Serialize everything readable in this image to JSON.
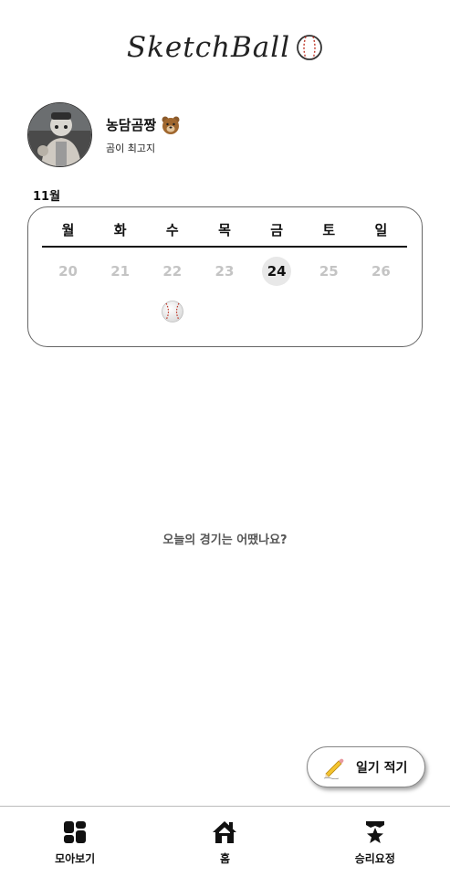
{
  "header": {
    "logo_text": "SketchBall",
    "logo_icon": "baseball-icon"
  },
  "profile": {
    "name": "농담곰짱",
    "name_emoji": "bear-face-icon",
    "bio": "곰이 최고지"
  },
  "calendar": {
    "month": "11월",
    "weekdays": [
      "월",
      "화",
      "수",
      "목",
      "금",
      "토",
      "일"
    ],
    "dates": [
      "20",
      "21",
      "22",
      "23",
      "24",
      "25",
      "26"
    ],
    "today": "24",
    "marked_dates": [
      "22"
    ],
    "mark_icon": "baseball-icon"
  },
  "main": {
    "empty_message": "오늘의 경기는 어땠나요?"
  },
  "write_button": {
    "label": "일기 적기",
    "icon": "pencil-icon"
  },
  "bottom_nav": {
    "items": [
      {
        "label": "모아보기",
        "icon": "grid-icon"
      },
      {
        "label": "홈",
        "icon": "home-icon"
      },
      {
        "label": "승리요정",
        "icon": "trophy-star-icon"
      }
    ]
  },
  "colors": {
    "text": "#111111",
    "muted_date": "#c4c4c4",
    "today_bg": "#e8e8e8",
    "border": "#666666"
  }
}
